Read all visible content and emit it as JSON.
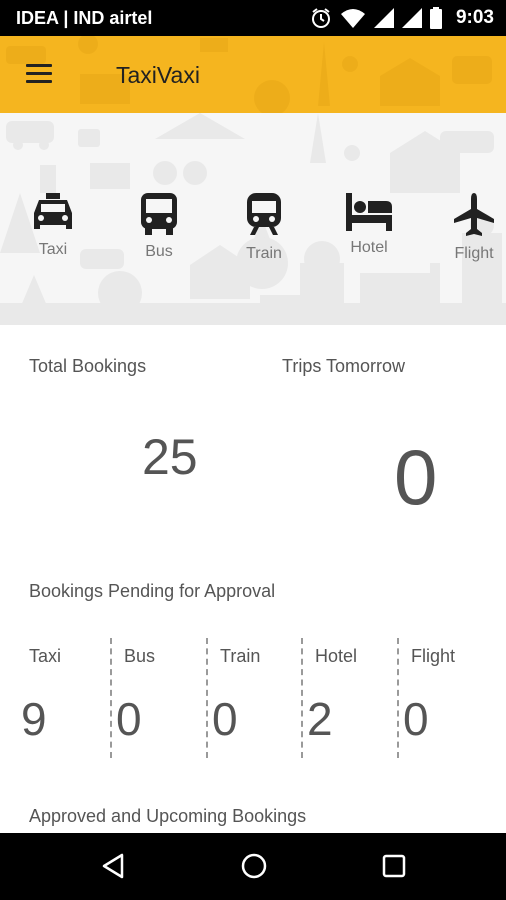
{
  "status_bar": {
    "carrier": "IDEA | IND airtel",
    "time": "9:03",
    "icons": [
      "alarm-icon",
      "wifi-icon",
      "signal-icon",
      "signal-icon",
      "battery-icon"
    ]
  },
  "app_bar": {
    "title": "TaxiVaxi",
    "menu_icon": "hamburger-menu-icon",
    "color": "#f5b51f"
  },
  "categories": [
    {
      "label": "Taxi",
      "icon": "taxi-icon"
    },
    {
      "label": "Bus",
      "icon": "bus-icon"
    },
    {
      "label": "Train",
      "icon": "train-icon"
    },
    {
      "label": "Hotel",
      "icon": "hotel-bed-icon"
    },
    {
      "label": "Flight",
      "icon": "airplane-icon"
    }
  ],
  "stats": {
    "total_bookings_label": "Total Bookings",
    "total_bookings_value": "25",
    "trips_tomorrow_label": "Trips Tomorrow",
    "trips_tomorrow_value": "0"
  },
  "pending": {
    "title": "Bookings Pending for Approval",
    "items": [
      {
        "label": "Taxi",
        "value": "9"
      },
      {
        "label": "Bus",
        "value": "0"
      },
      {
        "label": "Train",
        "value": "0"
      },
      {
        "label": "Hotel",
        "value": "2"
      },
      {
        "label": "Flight",
        "value": "0"
      }
    ]
  },
  "approved": {
    "title": "Approved and Upcoming Bookings"
  },
  "nav_bar": {
    "buttons": [
      "back-icon",
      "home-icon",
      "recents-icon"
    ]
  }
}
